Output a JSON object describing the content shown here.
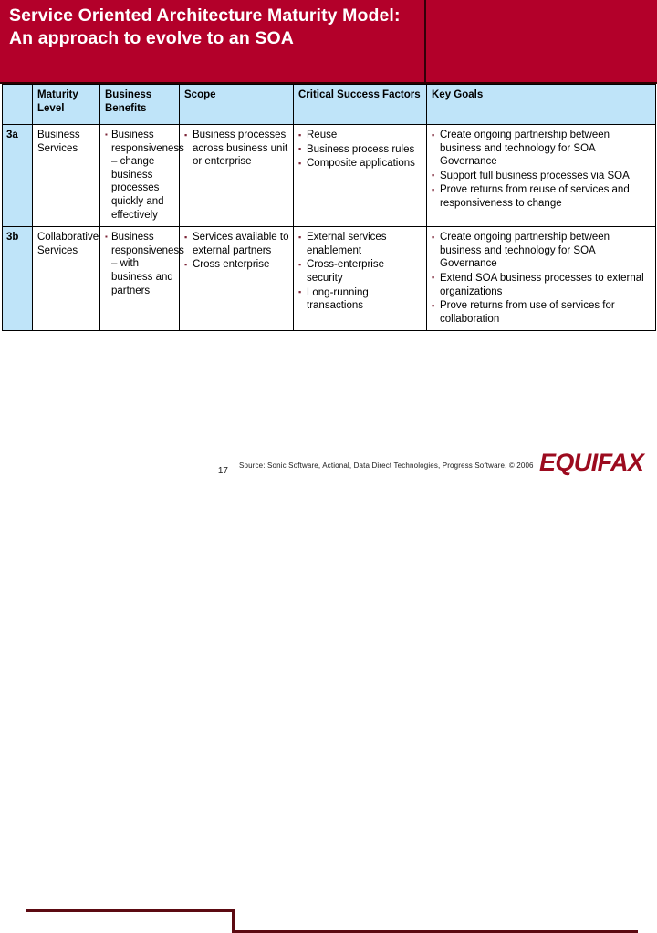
{
  "slide": {
    "title": "Service Oriented Architecture Maturity Model: An approach to evolve to an SOA",
    "banner_color": "#b3002a",
    "accent_color": "#9c0b1f",
    "header_cell_color": "#bfe4f9"
  },
  "table": {
    "headers": {
      "index": "",
      "maturity_level": "Maturity Level",
      "business_benefits": "Business Benefits",
      "scope": "Scope",
      "critical_success_factors": "Critical Success Factors",
      "key_goals": "Key Goals"
    },
    "rows": [
      {
        "index": "3a",
        "maturity_level": "Business Services",
        "business_benefits": [
          "Business responsiveness – change business processes quickly and effectively"
        ],
        "scope": [
          "Business processes across business unit or enterprise"
        ],
        "critical_success_factors": [
          "Reuse",
          "Business process rules",
          "Composite applications"
        ],
        "key_goals": [
          "Create ongoing partnership between business and technology for SOA Governance",
          "Support full business processes via SOA",
          "Prove returns from reuse of services and responsiveness to change"
        ]
      },
      {
        "index": "3b",
        "maturity_level": "Collaborative Services",
        "business_benefits": [
          "Business responsiveness – with business and partners"
        ],
        "scope": [
          "Services available to external partners",
          "Cross enterprise"
        ],
        "critical_success_factors": [
          "External services enablement",
          "Cross-enterprise security",
          "Long-running transactions"
        ],
        "key_goals": [
          "Create ongoing partnership between business and technology for SOA Governance",
          "Extend SOA business processes to external organizations",
          "Prove returns from use of services for collaboration"
        ]
      }
    ]
  },
  "footer": {
    "page_number": "17",
    "source_note": "Source: Sonic Software, Actional, Data Direct Technologies, Progress Software, © 2006",
    "logo_text": "EQUIFAX"
  }
}
